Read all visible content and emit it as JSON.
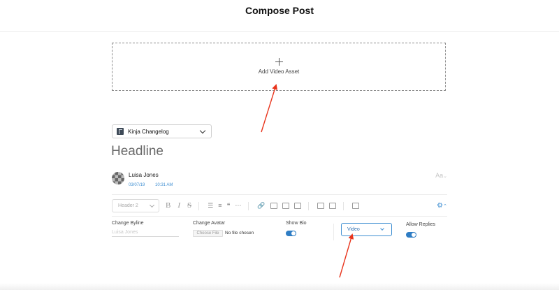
{
  "header": {
    "title": "Compose Post"
  },
  "video_asset": {
    "label": "Add Video Asset",
    "icon": "plus-icon"
  },
  "blog_select": {
    "value": "Kinja Changelog",
    "icon": "kinja-logo-icon"
  },
  "post": {
    "headline_placeholder": "Headline",
    "author": "Luisa Jones",
    "date": "03/07/19",
    "time": "10:31 AM",
    "text_size_toggle": "Aa"
  },
  "toolbar": {
    "format_select": "Header 2",
    "bold": "B",
    "italic": "I",
    "strike": "S",
    "bullet_list": "☰",
    "numbered_list": "≡",
    "quote": "❝",
    "more": "⋯",
    "link": "🔗"
  },
  "settings": {
    "byline_label": "Change Byline",
    "byline_placeholder": "Luisa Jones",
    "avatar_label": "Change Avatar",
    "choose_file": "Choose File",
    "no_file": "No file chosen",
    "show_bio_label": "Show Bio",
    "type_value": "Video",
    "allow_replies_label": "Allow Replies"
  },
  "colors": {
    "accent": "#3f8fd2",
    "toggle_on": "#2f7dc4",
    "annotation_arrow": "#e8341c"
  }
}
